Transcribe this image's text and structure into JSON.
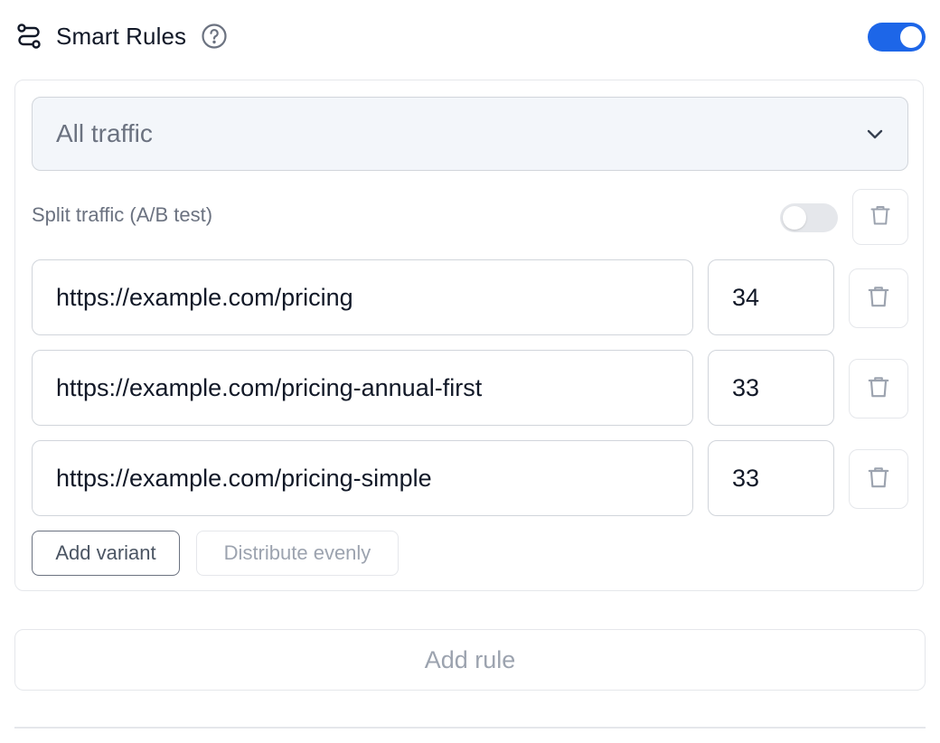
{
  "header": {
    "title": "Smart Rules",
    "enabled": true
  },
  "rule": {
    "audience_select": {
      "value": "All traffic"
    },
    "split_traffic": {
      "label": "Split traffic (A/B test)",
      "enabled": false
    },
    "variants": [
      {
        "url": "https://example.com/pricing",
        "percent": "34"
      },
      {
        "url": "https://example.com/pricing-annual-first",
        "percent": "33"
      },
      {
        "url": "https://example.com/pricing-simple",
        "percent": "33"
      }
    ],
    "buttons": {
      "add_variant": "Add variant",
      "distribute_evenly": "Distribute evenly"
    }
  },
  "add_rule_label": "Add rule",
  "colors": {
    "accent": "#1d66e8",
    "border": "#e5e7eb",
    "muted_text": "#6b7280"
  },
  "icons": {
    "header": "routing-icon",
    "help": "help-circle-icon",
    "select": "chevron-down-icon",
    "delete": "trash-icon"
  }
}
